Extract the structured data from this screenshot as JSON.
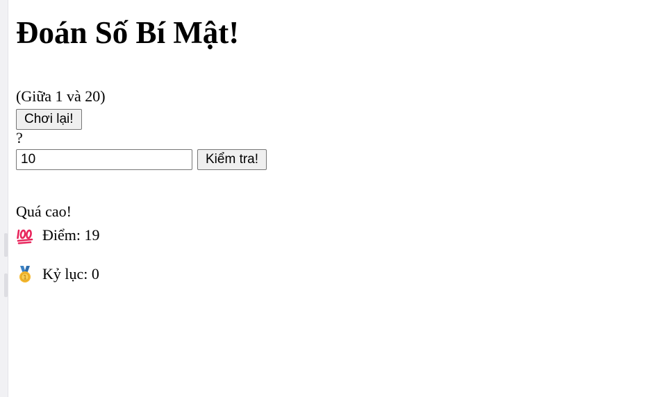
{
  "game": {
    "title": "Đoán Số Bí Mật!",
    "range_hint": "(Giữa 1 và 20)",
    "replay_label": "Chơi lại!",
    "secret_display": "?",
    "guess_value": "10",
    "check_label": "Kiểm tra!",
    "message": "Quá cao!",
    "score_text": "Điểm: 19",
    "highscore_text": "Kỷ lục: 0"
  },
  "icons": {
    "score": "hundred-points-icon",
    "highscore": "medal-icon"
  },
  "colors": {
    "hundred_points": "#e8245b",
    "medal_gold": "#f5b82e",
    "medal_ribbon": "#3b82c4"
  }
}
